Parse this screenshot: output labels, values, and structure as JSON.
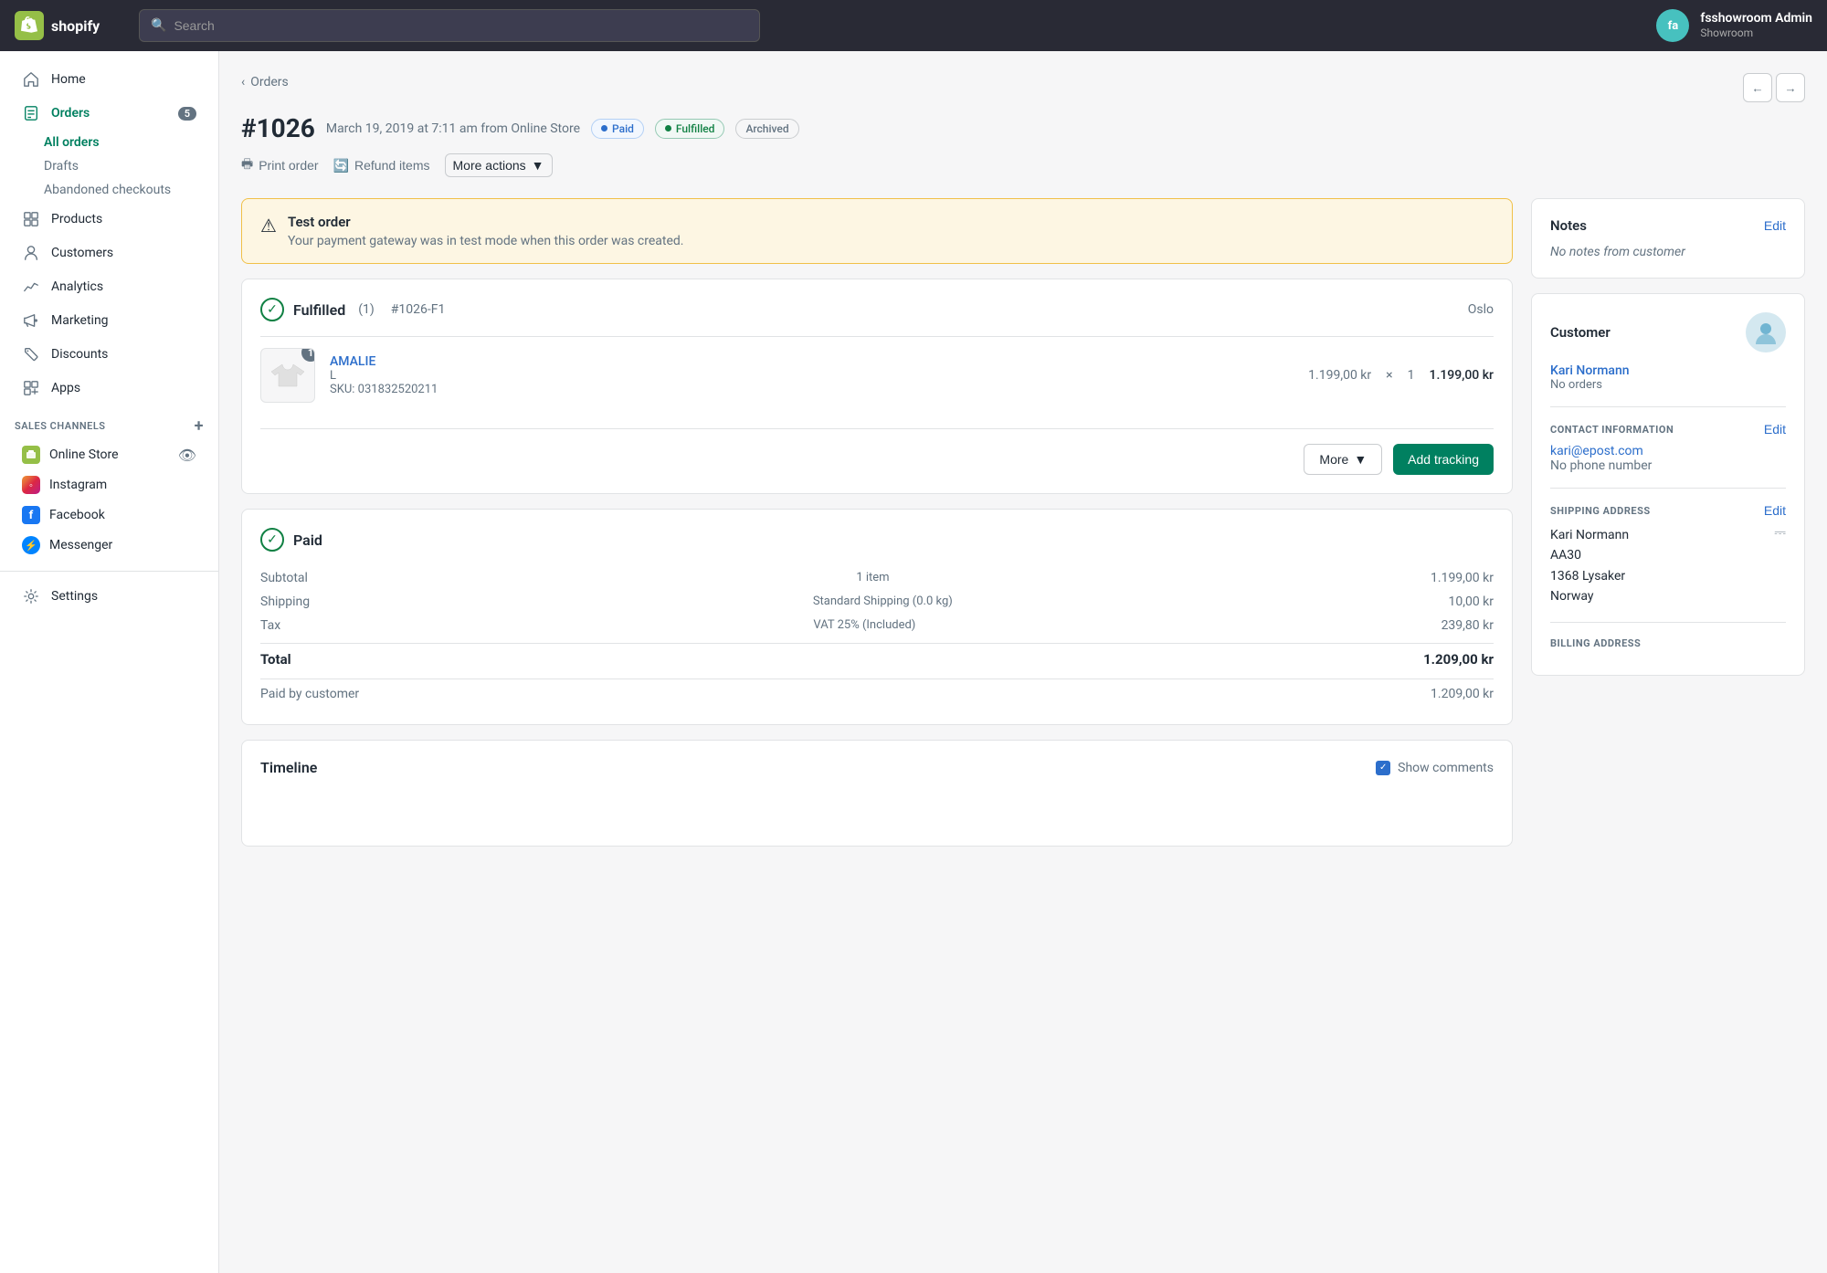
{
  "topnav": {
    "logo_text": "shopify",
    "search_placeholder": "Search",
    "user_initials": "fa",
    "user_name": "fsshowroom Admin",
    "user_store": "Showroom"
  },
  "sidebar": {
    "items": [
      {
        "id": "home",
        "label": "Home",
        "icon": "home"
      },
      {
        "id": "orders",
        "label": "Orders",
        "icon": "orders",
        "badge": "5"
      },
      {
        "id": "products",
        "label": "Products",
        "icon": "products"
      },
      {
        "id": "customers",
        "label": "Customers",
        "icon": "customers"
      },
      {
        "id": "analytics",
        "label": "Analytics",
        "icon": "analytics"
      },
      {
        "id": "marketing",
        "label": "Marketing",
        "icon": "marketing"
      },
      {
        "id": "discounts",
        "label": "Discounts",
        "icon": "discounts"
      },
      {
        "id": "apps",
        "label": "Apps",
        "icon": "apps"
      }
    ],
    "orders_subitems": [
      {
        "id": "all-orders",
        "label": "All orders",
        "active": true
      },
      {
        "id": "drafts",
        "label": "Drafts"
      },
      {
        "id": "abandoned",
        "label": "Abandoned checkouts"
      }
    ],
    "sales_channels_label": "SALES CHANNELS",
    "channels": [
      {
        "id": "online-store",
        "label": "Online Store",
        "color": "#95bf47"
      },
      {
        "id": "instagram",
        "label": "Instagram",
        "color": "#c13584"
      },
      {
        "id": "facebook",
        "label": "Facebook",
        "color": "#1877f2"
      },
      {
        "id": "messenger",
        "label": "Messenger",
        "color": "#0084ff"
      }
    ],
    "settings_label": "Settings"
  },
  "breadcrumb": {
    "back_label": "Orders"
  },
  "order": {
    "number": "#1026",
    "date": "March 19, 2019 at 7:11 am from Online Store",
    "badges": {
      "paid": "Paid",
      "fulfilled": "Fulfilled",
      "archived": "Archived"
    }
  },
  "actions": {
    "print": "Print order",
    "refund": "Refund items",
    "more": "More actions"
  },
  "warning": {
    "title": "Test order",
    "text": "Your payment gateway was in test mode when this order was created."
  },
  "fulfilled": {
    "title": "Fulfilled",
    "count": "(1)",
    "fulfillment_id": "#1026-F1",
    "location": "Oslo",
    "product_name": "AMALIE",
    "product_variant": "L",
    "product_sku": "SKU: 031832520211",
    "product_price": "1.199,00 kr",
    "product_qty": "× 1",
    "product_total": "1.199,00 kr",
    "product_badge": "1",
    "more_btn": "More",
    "add_tracking_btn": "Add tracking"
  },
  "payment": {
    "title": "Paid",
    "subtotal_label": "Subtotal",
    "subtotal_items": "1 item",
    "subtotal_value": "1.199,00 kr",
    "shipping_label": "Shipping",
    "shipping_sublabel": "Standard Shipping (0.0 kg)",
    "shipping_value": "10,00 kr",
    "tax_label": "Tax",
    "tax_sublabel": "VAT 25% (Included)",
    "tax_value": "239,80 kr",
    "total_label": "Total",
    "total_value": "1.209,00 kr",
    "paid_label": "Paid by customer",
    "paid_value": "1.209,00 kr"
  },
  "timeline": {
    "title": "Timeline",
    "show_comments_label": "Show comments"
  },
  "notes": {
    "title": "Notes",
    "edit_label": "Edit",
    "empty_text": "No notes from customer"
  },
  "customer": {
    "title": "Customer",
    "name": "Kari Normann",
    "orders_text": "No orders",
    "contact_label": "CONTACT INFORMATION",
    "edit_contact_label": "Edit",
    "email": "kari@epost.com",
    "phone": "No phone number",
    "shipping_label": "SHIPPING ADDRESS",
    "edit_shipping_label": "Edit",
    "shipping_name": "Kari Normann",
    "shipping_street": "AA30",
    "shipping_city": "1368 Lysaker",
    "shipping_country": "Norway",
    "billing_label": "BILLING ADDRESS"
  }
}
